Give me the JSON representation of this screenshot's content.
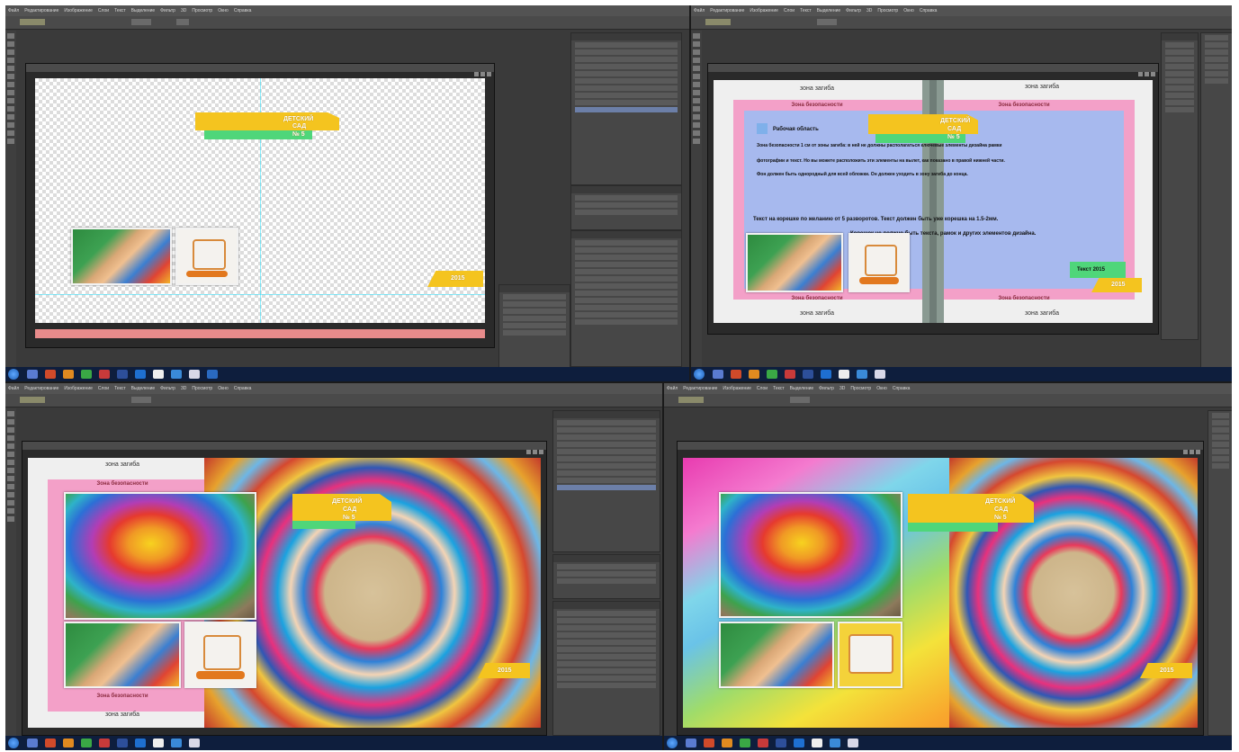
{
  "menu": [
    "Файл",
    "Редактирование",
    "Изображение",
    "Слои",
    "Текст",
    "Выделение",
    "Фильтр",
    "3D",
    "Просмотр",
    "Окно",
    "Справка"
  ],
  "q1": {
    "banner": {
      "line1": "ДЕТСКИЙ",
      "line2": "САД",
      "line3": "№ 5"
    },
    "year": "2015"
  },
  "q2": {
    "fold_top_left": "зона загиба",
    "fold_top_right": "зона загиба",
    "fold_bottom_left": "зона загиба",
    "fold_bottom_right": "зона загиба",
    "safe_top_left": "Зона безопасности",
    "safe_top_right": "Зона безопасности",
    "safe_bottom_left": "Зона безопасности",
    "safe_bottom_right": "Зона безопасности",
    "work_area": "Рабочая область",
    "para1": "Зона безопасности 1 см от зоны загиба: в ней не должны располагаться ключевые элементы дизайна рамки",
    "para2": "фотографии и текст. Но вы можете расположить эти элементы на вылет, как показано в правой нижней части.",
    "para3": "Фон должен быть однородный для всей обложки. Он должен уходить в зону загиба до конца.",
    "spine1": "Текст на корешке по желанию от 5 разворотов. Текст должен быть уже корешка на 1.5-2мм.",
    "spine2": "Корешок не должно быть текста, рамок и других элементов дизайна.",
    "green_label": "Текст 2015",
    "banner": {
      "line1": "ДЕТСКИЙ",
      "line2": "САД",
      "line3": "№ 5"
    },
    "year": "2015"
  },
  "q3": {
    "fold_top": "зона загиба",
    "safe_top": "Зона безопасности",
    "safe_bottom": "Зона безопасности",
    "fold_bottom": "зона загиба",
    "banner": {
      "line1": "ДЕТСКИЙ",
      "line2": "САД",
      "line3": "№ 5"
    },
    "year": "2015"
  },
  "q4": {
    "banner": {
      "line1": "ДЕТСКИЙ",
      "line2": "САД",
      "line3": "№ 5"
    },
    "year": "2015"
  },
  "colors": {
    "banner_yellow": "#f4c41f",
    "banner_green": "#4fd67a",
    "safe_pink": "#f3a0c8",
    "work_blue": "#a7b9ee",
    "ps_bg": "#3a3a3a"
  }
}
